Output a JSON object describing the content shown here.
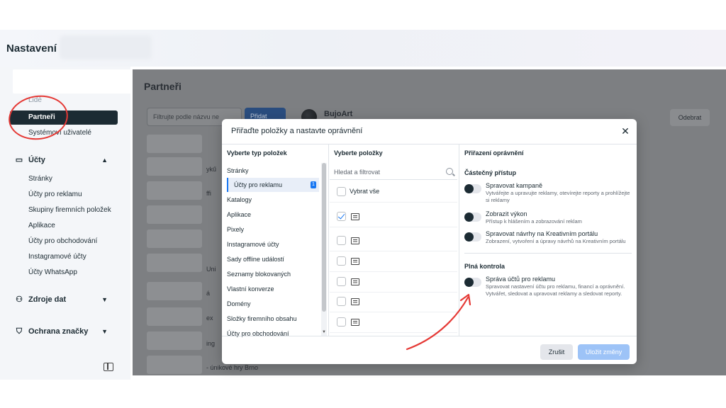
{
  "header": {
    "title": "Nastavení"
  },
  "sidebar": {
    "cut_item": "Lidé",
    "items": [
      {
        "label": "Partneři",
        "active": true
      },
      {
        "label": "Systémoví uživatelé",
        "active": false
      }
    ],
    "sections": [
      {
        "label": "Účty",
        "icon": "folder-icon",
        "chevron": "up"
      },
      {
        "label": "Zdroje dat",
        "icon": "data-sources-icon",
        "chevron": "down"
      },
      {
        "label": "Ochrana značky",
        "icon": "shield-icon",
        "chevron": "down"
      }
    ],
    "account_items": [
      "Stránky",
      "Účty pro reklamu",
      "Skupiny firemních položek",
      "Aplikace",
      "Účty pro obchodování",
      "Instagramové účty",
      "Účty WhatsApp"
    ]
  },
  "main": {
    "title": "Partneři",
    "filter_placeholder": "Filtrujte podle názvu ne",
    "add_label": "Přidat",
    "partner_name": "BujoArt",
    "remove_label": "Odebrat",
    "peek_texts": [
      "ykű",
      "ffi",
      "Uni",
      "á",
      "ex",
      "ing",
      "- únikové hry Brno"
    ]
  },
  "modal": {
    "title": "Přiřaďte položky a nastavte oprávnění",
    "col1_title": "Vyberte typ položek",
    "col2_title": "Vyberte položky",
    "col3_title": "Přiřazení oprávnění",
    "types": [
      "Stránky",
      "Účty pro reklamu",
      "Katalogy",
      "Aplikace",
      "Pixely",
      "Instagramové účty",
      "Sady offline událostí",
      "Seznamy blokovaných",
      "Vlastní konverze",
      "Domény",
      "Složky firemního obsahu",
      "Účty pro obchodování"
    ],
    "selected_count": "1",
    "search_placeholder": "Hledat a filtrovat",
    "select_all": "Vybrat vše",
    "partial_access": "Částečný přístup",
    "full_control": "Plná kontrola",
    "permissions": [
      {
        "name": "Spravovat kampaně",
        "desc": "Vytvářejte a upravujte reklamy, otevírejte reporty a prohlížejte si reklamy"
      },
      {
        "name": "Zobrazit výkon",
        "desc": "Přístup k hlášením a zobrazování reklam"
      },
      {
        "name": "Spravovat návrhy na Kreativním portálu",
        "desc": "Zobrazení, vytvoření a úpravy návrhů na Kreativním portálu"
      },
      {
        "name": "Správa účtů pro reklamu",
        "desc": "Spravovat nastavení účtu pro reklamu, financí a oprávnění. Vytvářet, sledovat a upravovat reklamy a sledovat reporty."
      }
    ],
    "cancel_label": "Zrušit",
    "save_label": "Uložit změny"
  },
  "colors": {
    "primary": "#1877f2",
    "annotation": "#e53935",
    "dark": "#1c2b33"
  }
}
